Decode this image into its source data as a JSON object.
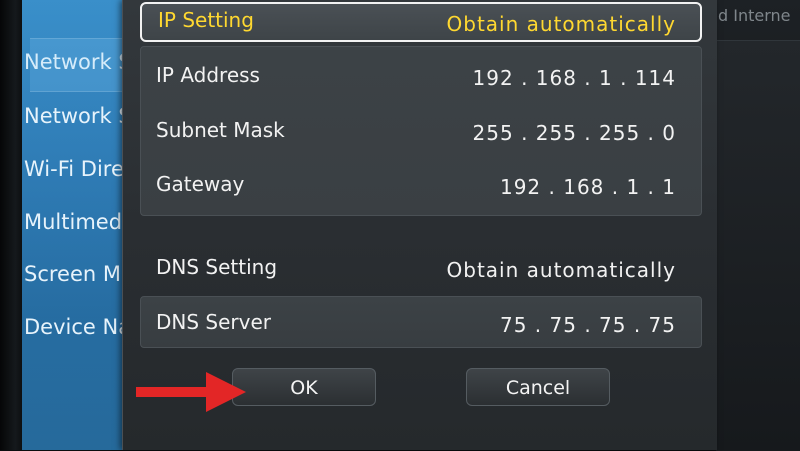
{
  "sidebar": {
    "items": [
      {
        "label": "Network Status"
      },
      {
        "label": "Network Settings"
      },
      {
        "label": "Wi-Fi Direct"
      },
      {
        "label": "Multimedia Device Settings"
      },
      {
        "label": "Screen Mirroring"
      },
      {
        "label": "Device Name"
      }
    ]
  },
  "background_right": {
    "text": "d Interne"
  },
  "dialog": {
    "ip_setting": {
      "label": "IP Setting",
      "value": "Obtain automatically"
    },
    "ip_address": {
      "label": "IP Address",
      "value": "192 . 168 . 1 . 114"
    },
    "subnet_mask": {
      "label": "Subnet Mask",
      "value": "255 . 255 . 255 . 0"
    },
    "gateway": {
      "label": "Gateway",
      "value": "192 . 168 . 1 . 1"
    },
    "dns_setting": {
      "label": "DNS Setting",
      "value": "Obtain automatically"
    },
    "dns_server": {
      "label": "DNS Server",
      "value": "75 . 75 . 75 . 75"
    },
    "ok_label": "OK",
    "cancel_label": "Cancel"
  },
  "colors": {
    "highlight_text": "#ffd830",
    "menu_blue": "#2a7ebd",
    "annotation_arrow": "#e32626"
  },
  "icons": {
    "annotation": "red-arrow-icon"
  }
}
